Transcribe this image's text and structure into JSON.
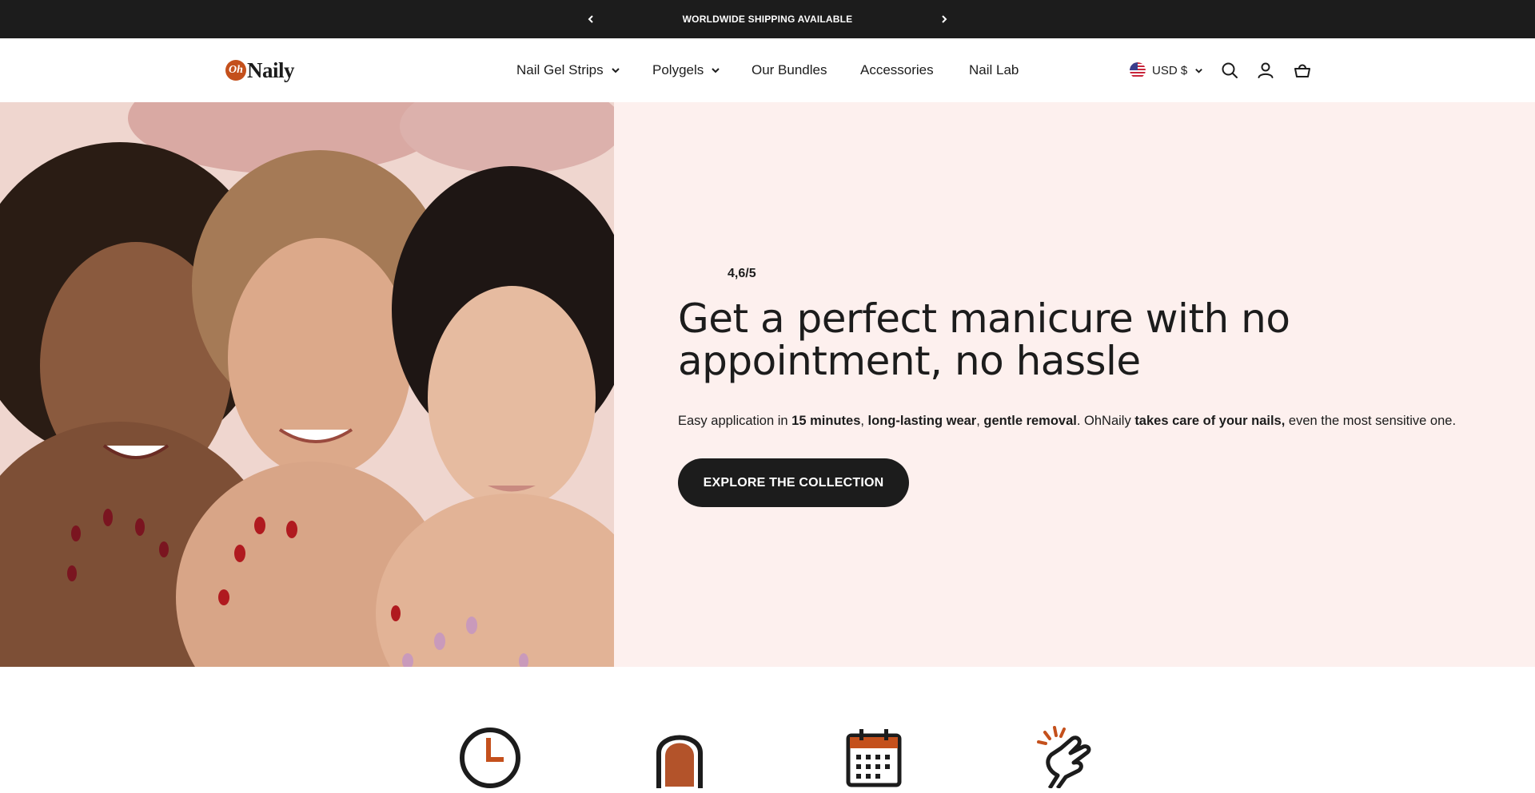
{
  "announcement": {
    "message": "WORLDWIDE SHIPPING AVAILABLE",
    "prev_icon": "chevron-left-icon",
    "next_icon": "chevron-right-icon"
  },
  "header": {
    "logo": {
      "mark": "Oh",
      "word": "Naily"
    },
    "nav": [
      {
        "label": "Nail Gel Strips",
        "has_dropdown": true
      },
      {
        "label": "Polygels",
        "has_dropdown": true
      },
      {
        "label": "Our Bundles",
        "has_dropdown": false
      },
      {
        "label": "Accessories",
        "has_dropdown": false
      },
      {
        "label": "Nail Lab",
        "has_dropdown": false
      }
    ],
    "currency": {
      "label": "USD $",
      "flag": "us-flag-icon"
    },
    "icons": [
      "search-icon",
      "account-icon",
      "cart-icon"
    ]
  },
  "hero": {
    "rating": {
      "value": "4,6/5"
    },
    "headline": "Get a perfect manicure with no appointment, no hassle",
    "subtext": {
      "p1": "Easy application in ",
      "b1": "15 minutes",
      "p2": ", ",
      "b2": "long-lasting wear",
      "p3": ", ",
      "b3": "gentle removal",
      "p4": ". OhNaily ",
      "b4": "takes care of your nails,",
      "p5": " even the most sensitive one."
    },
    "cta_label": "EXPLORE THE COLLECTION"
  },
  "features": {
    "icons": [
      "clock-icon",
      "nail-icon",
      "calendar-icon",
      "hand-snap-icon"
    ]
  },
  "colors": {
    "dark": "#1c1c1c",
    "hero_bg": "#fdf0ee",
    "accent": "#c4501c",
    "white": "#ffffff"
  }
}
